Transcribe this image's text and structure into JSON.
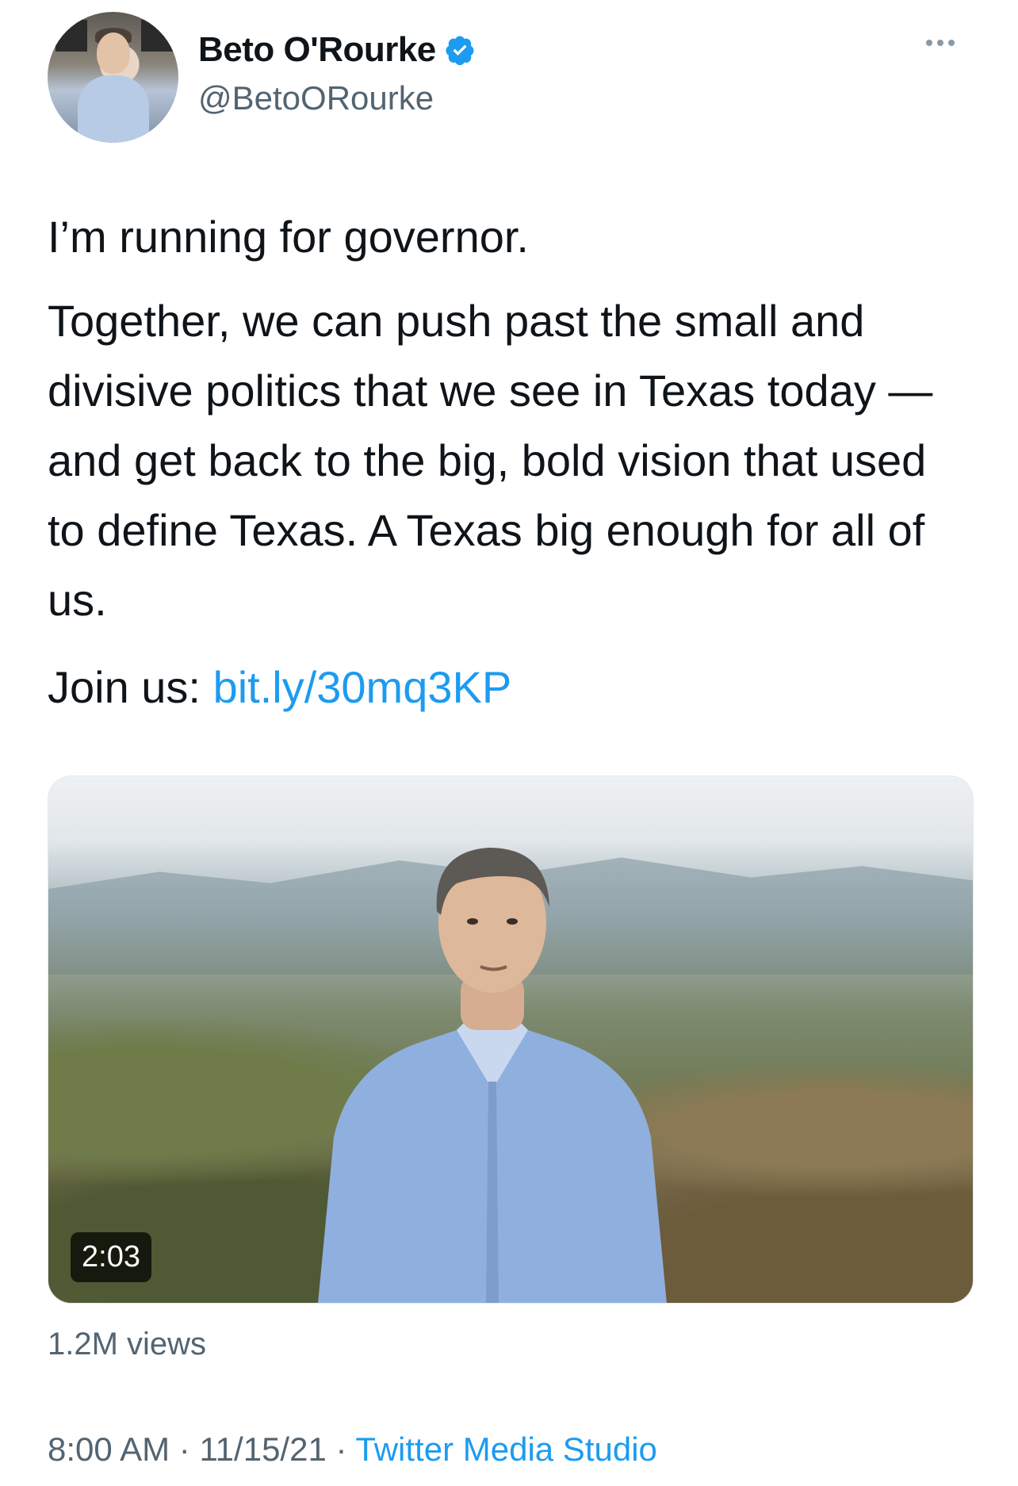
{
  "author": {
    "name": "Beto O'Rourke",
    "handle": "@BetoORourke",
    "verified": true
  },
  "tweet": {
    "line1": "I’m running for governor.",
    "line2": "Together, we can push past the small and divisive politics that we see in Texas today — and get back to the big, bold vision that used to define Texas. A Texas big enough for all of us.",
    "join_prefix": "Join us: ",
    "link_text": "bit.ly/30mq3KP"
  },
  "media": {
    "type": "video",
    "duration": "2:03",
    "views": "1.2M views"
  },
  "meta": {
    "time": "8:00 AM",
    "sep1": " · ",
    "date": "11/15/21",
    "sep2": " · ",
    "source": "Twitter Media Studio"
  },
  "colors": {
    "accent": "#1d9bf0",
    "secondary_text": "#536471",
    "primary_text": "#0f1419"
  },
  "icons": [
    "verified-badge-icon",
    "more-options-icon"
  ]
}
